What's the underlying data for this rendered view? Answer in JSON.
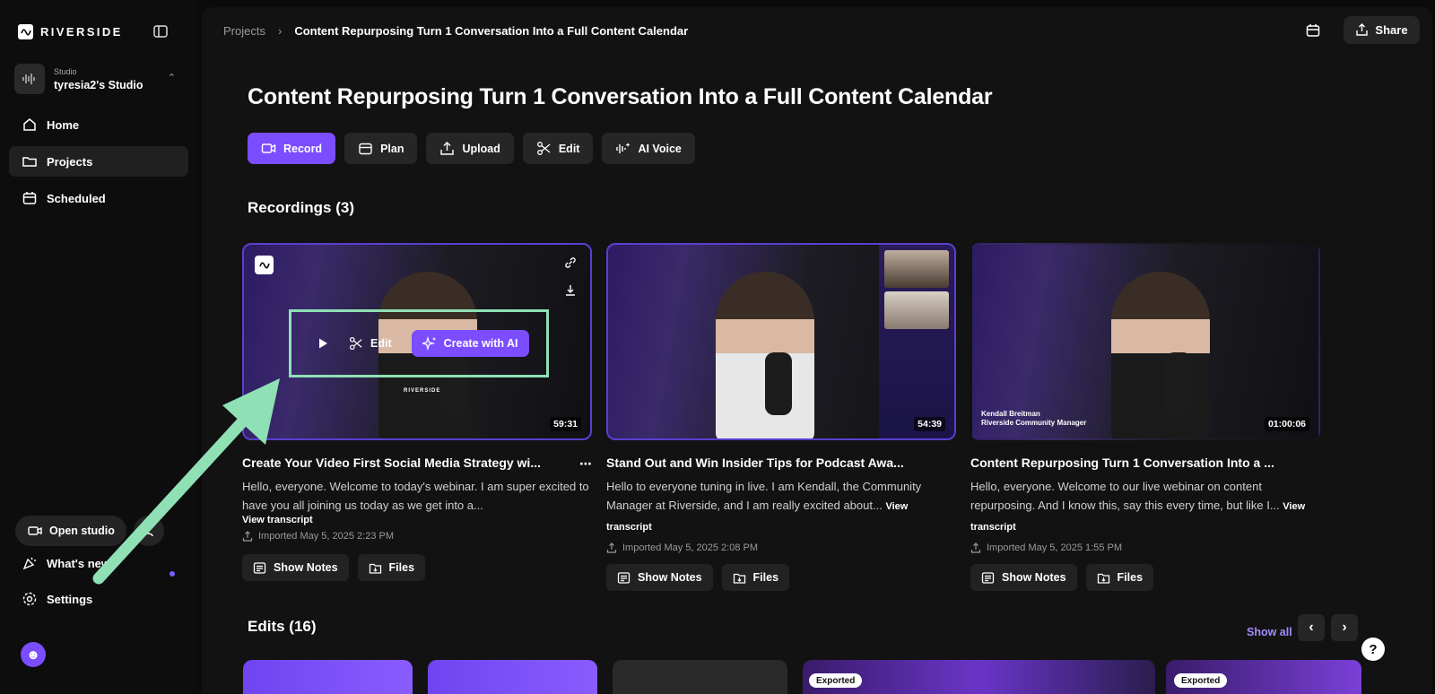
{
  "brand": {
    "name": "RIVERSIDE"
  },
  "studio": {
    "label": "Studio",
    "name": "tyresia2's Studio"
  },
  "nav": [
    {
      "label": "Home",
      "icon": "home-icon"
    },
    {
      "label": "Projects",
      "icon": "folder-icon",
      "active": true
    },
    {
      "label": "Scheduled",
      "icon": "calendar-icon"
    }
  ],
  "sidebar_bottom": {
    "open_studio": "Open studio",
    "whats_new": "What's new?",
    "settings": "Settings"
  },
  "breadcrumb": {
    "root": "Projects",
    "current": "Content Repurposing Turn 1 Conversation Into a Full Content Calendar"
  },
  "header": {
    "share": "Share"
  },
  "page_title": "Content Repurposing Turn 1 Conversation Into a Full Content Calendar",
  "actions": [
    "Record",
    "Plan",
    "Upload",
    "Edit",
    "AI Voice"
  ],
  "recordings_title": "Recordings (3)",
  "recordings": [
    {
      "title": "Create Your Video First Social Media Strategy wi...",
      "desc": "Hello, everyone. Welcome to today's webinar. I am super excited to have you all joining us today as we get into a...",
      "transcript": "View transcript",
      "imported": "Imported May 5, 2025 2:23 PM",
      "duration": "59:31",
      "overlay_mark": "RIVERSIDE"
    },
    {
      "title": "Stand Out and Win Insider Tips for Podcast Awa...",
      "desc": "Hello to everyone tuning in live. I am Kendall, the Community Manager at Riverside, and I am really excited about...",
      "transcript": "View transcript",
      "imported": "Imported May 5, 2025 2:08 PM",
      "duration": "54:39"
    },
    {
      "title": "Content Repurposing Turn 1 Conversation Into a ...",
      "desc": "Hello, everyone. Welcome to our live webinar on content repurposing. And I know this, say this every time, but like I...",
      "transcript": "View transcript",
      "imported": "Imported May 5, 2025 1:55 PM",
      "duration": "01:00:06",
      "caption_name": "Kendall Breitman",
      "caption_role": "Riverside Community Manager"
    }
  ],
  "hover": {
    "edit": "Edit",
    "create_ai": "Create with AI"
  },
  "card_buttons": {
    "notes": "Show Notes",
    "files": "Files"
  },
  "edits_title": "Edits (16)",
  "show_all": "Show all",
  "exported": "Exported",
  "help": "?",
  "colors": {
    "accent": "#7b4dff",
    "annotation": "#8fe0b5"
  }
}
